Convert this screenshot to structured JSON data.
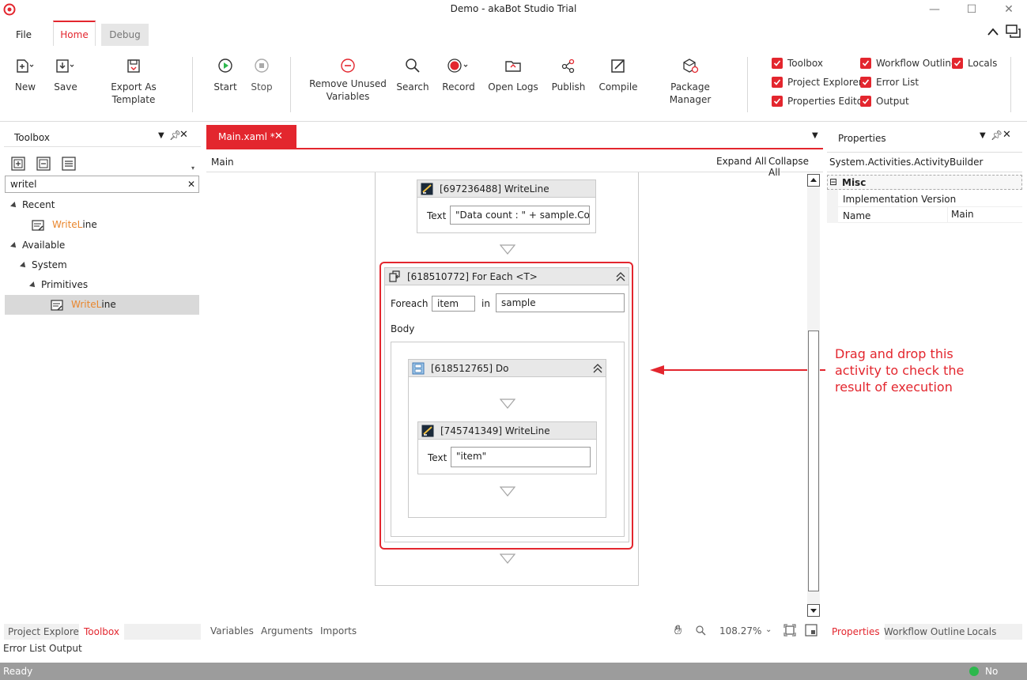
{
  "window": {
    "title": "Demo - akaBot Studio Trial"
  },
  "menu_tabs": [
    "File",
    "Home",
    "Debug"
  ],
  "ribbon": {
    "buttons": [
      "New",
      "Save",
      "Export As Template",
      "Start",
      "Stop",
      "Remove Unused Variables",
      "Search",
      "Record",
      "Open Logs",
      "Publish",
      "Compile",
      "Package Manager"
    ],
    "panel_checks": [
      "Toolbox",
      "Workflow Outline",
      "Locals",
      "Project Explorer",
      "Error List",
      "Properties Editor",
      "Output"
    ]
  },
  "toolbox": {
    "title": "Toolbox",
    "search_value": "writel",
    "tree": {
      "recent": "Recent",
      "recent_item_match": "WriteL",
      "recent_item_rest": "ine",
      "available": "Available",
      "system": "System",
      "primitives": "Primitives",
      "item_match": "WriteL",
      "item_rest": "ine"
    },
    "bottom_tabs": [
      "Project Explorer",
      "Toolbox"
    ],
    "bottom_tabs2": [
      "Error List",
      "Output"
    ]
  },
  "designer": {
    "tab_label": "Main.xaml *",
    "breadcrumb": "Main",
    "expand_all": "Expand All",
    "collapse_all": "Collapse All",
    "writeline1": {
      "title": "[697236488] WriteLine",
      "text_label": "Text",
      "text_value": "\"Data count : \" + sample.Cou"
    },
    "foreach": {
      "title": "[618510772] For Each <T>",
      "foreach_label": "Foreach",
      "var": "item",
      "in_label": "in",
      "source": "sample",
      "body_label": "Body"
    },
    "do": {
      "title": "[618512765] Do"
    },
    "writeline2": {
      "title": "[745741349] WriteLine",
      "text_label": "Text",
      "text_value": "\"item\""
    },
    "annotation": "Drag and drop this activity to check the result of execution",
    "bottom_tabs": [
      "Variables",
      "Arguments",
      "Imports"
    ],
    "zoom": "108.27%"
  },
  "properties": {
    "title": "Properties",
    "object": "System.Activities.ActivityBuilder",
    "section": "Misc",
    "rows": [
      {
        "name": "Implementation Version",
        "value": ""
      },
      {
        "name": "Name",
        "value": "Main"
      }
    ],
    "bottom_tabs": [
      "Properties",
      "Workflow Outline",
      "Locals"
    ]
  },
  "status": {
    "left": "Ready",
    "right": "No Errors"
  },
  "colors": {
    "accent": "#e3262e",
    "status_bar": "#9c9c9c",
    "success": "#2db84d"
  }
}
